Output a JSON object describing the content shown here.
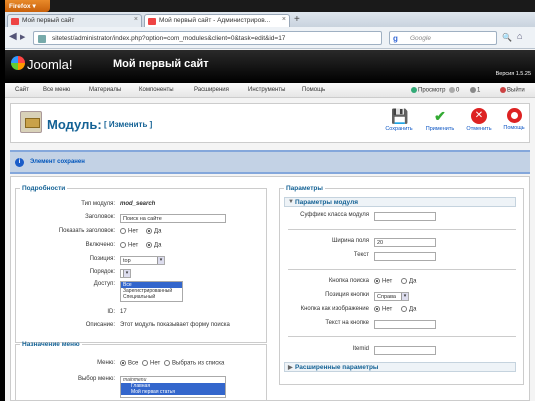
{
  "browser": {
    "menu_button": "Firefox",
    "tabs": [
      {
        "title": "Мой первый сайт"
      },
      {
        "title": "Мой первый сайт - Администриров..."
      }
    ],
    "new_tab": "+",
    "url": "sitetest/administrator/index.php?option=com_modules&client=0&task=edit&id=17",
    "search_engine": "Google",
    "search_placeholder": "Google"
  },
  "header": {
    "logo_text": "Joomla!",
    "site_name": "Мой первый сайт",
    "version": "Версия 1.5.25"
  },
  "menu": {
    "items": [
      "Сайт",
      "Все меню",
      "Материалы",
      "Компоненты",
      "Расширения",
      "Инструменты",
      "Помощь"
    ],
    "right": {
      "preview": "Просмотр",
      "messages": "0",
      "users": "1",
      "logout": "Выйти"
    }
  },
  "toolbar": {
    "title": "Модуль:",
    "subtitle": "[ Изменить ]",
    "buttons": [
      {
        "label": "Сохранить",
        "icon": "save-icon"
      },
      {
        "label": "Применить",
        "icon": "apply-checkmark-icon"
      },
      {
        "label": "Отменить",
        "icon": "cancel-icon"
      },
      {
        "label": "Помощь",
        "icon": "help-lifebuoy-icon"
      }
    ]
  },
  "message": "Элемент сохранен",
  "details": {
    "legend": "Подробности",
    "type_label": "Тип модуля:",
    "type_value": "mod_search",
    "title_label": "Заголовок:",
    "title_value": "Поиск на сайте",
    "show_title_label": "Показать заголовок:",
    "show_title": {
      "no": "Нет",
      "yes": "Да",
      "selected": "yes"
    },
    "enabled_label": "Включено:",
    "enabled": {
      "no": "Нет",
      "yes": "Да",
      "selected": "yes"
    },
    "position_label": "Позиция:",
    "position_value": "top",
    "order_label": "Порядок:",
    "order_value": "",
    "access_label": "Доступ:",
    "access_options": [
      "Все",
      "Зарегистрированный",
      "Специальный"
    ],
    "access_selected": "Все",
    "id_label": "ID:",
    "id_value": "17",
    "desc_label": "Описание:",
    "desc_value": "Этот модуль показывает форму поиска"
  },
  "menu_assign": {
    "legend": "Назначение меню",
    "menus_label": "Меню:",
    "menus": {
      "all": "Все",
      "none": "Нет",
      "select": "Выбрать из списка",
      "selected": "all"
    },
    "select_label": "Выбор меню:",
    "list": [
      "mainmenu",
      "Главная",
      "Мой первая статья"
    ]
  },
  "params": {
    "legend": "Параметры",
    "section_module": "Параметры модуля",
    "suffix_label": "Суффикс класса модуля",
    "suffix_value": "",
    "width_label": "Ширина поля",
    "width_value": "20",
    "text_label": "Текст",
    "text_value": "",
    "search_btn_label": "Кнопка поиска",
    "search_btn": {
      "no": "Нет",
      "yes": "Да",
      "selected": "no"
    },
    "btn_pos_label": "Позиция кнопки",
    "btn_pos_value": "Справа",
    "img_btn_label": "Кнопка как изображение",
    "img_btn": {
      "no": "Нет",
      "yes": "Да",
      "selected": "no"
    },
    "btn_text_label": "Текст на кнопке",
    "btn_text_value": "",
    "itemid_label": "Itemid",
    "itemid_value": "",
    "section_advanced": "Расширенные параметры"
  }
}
